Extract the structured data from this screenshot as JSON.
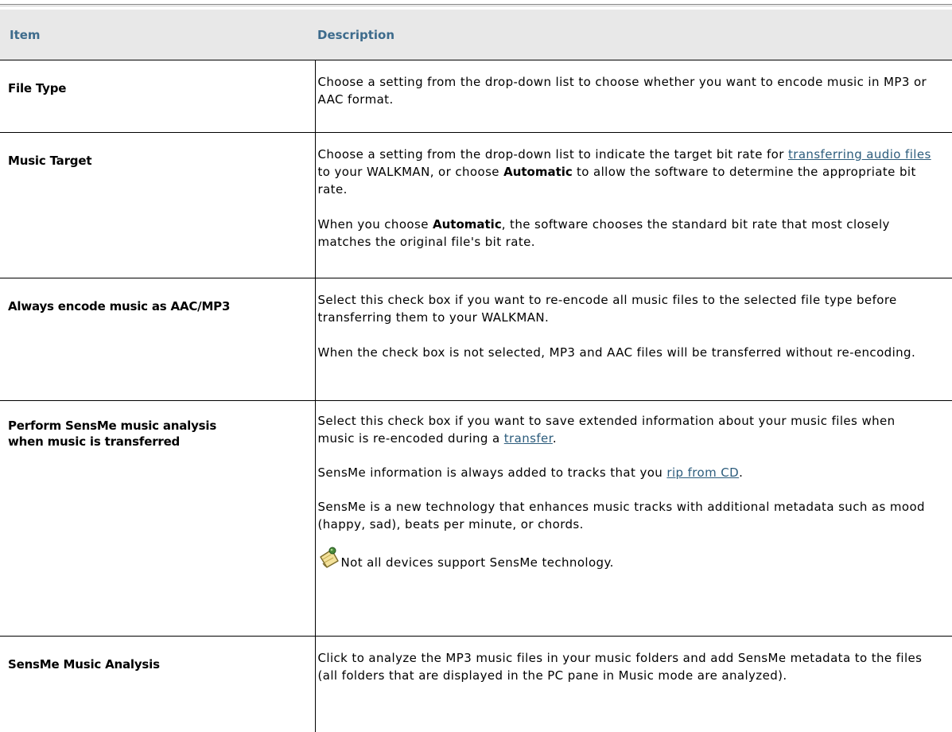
{
  "header": {
    "item": "Item",
    "description": "Description"
  },
  "rows": [
    {
      "item": "File Type",
      "desc": [
        "Choose a setting from the drop-down list to choose whether you want to encode music in MP3 or AAC format."
      ]
    },
    {
      "item": "Music Target",
      "desc_p1": {
        "before": "Choose a setting from the drop-down list to indicate the target bit rate for ",
        "link": "transferring audio files",
        "middle": " to your WALKMAN, or choose ",
        "bold": "Automatic",
        "after": " to allow the software to determine the appropriate bit rate."
      },
      "desc_p2": {
        "before": "When you choose ",
        "bold": "Automatic",
        "after": ", the software chooses the standard bit rate that most closely matches the original file's bit rate."
      }
    },
    {
      "item": "Always encode music as AAC/MP3",
      "desc": [
        "Select this check box if you want to re-encode all music files to the selected file type before transferring them to your WALKMAN.",
        "When the check box is not selected, MP3 and AAC files will be transferred without re-encoding."
      ]
    },
    {
      "item_line1": "Perform SensMe music analysis",
      "item_line2": "when music is transferred",
      "desc_p1": {
        "before": "Select this check box if you want to save extended information about your music files when music is re-encoded during a ",
        "link": "transfer",
        "after": "."
      },
      "desc_p2": {
        "before": "SensMe information is always added to tracks that you ",
        "link": "rip from CD",
        "after": "."
      },
      "desc_p3": "SensMe is a new technology that enhances music tracks with additional metadata such as mood (happy, sad), beats per minute, or chords.",
      "note": {
        "icon": "note-icon",
        "text": "Not all devices support SensMe technology."
      }
    },
    {
      "item": "SensMe Music Analysis",
      "desc": [
        "Click to analyze the MP3 music files in your music folders and add SensMe metadata to the files (all folders that are displayed in the PC pane in Music mode are analyzed)."
      ]
    }
  ]
}
